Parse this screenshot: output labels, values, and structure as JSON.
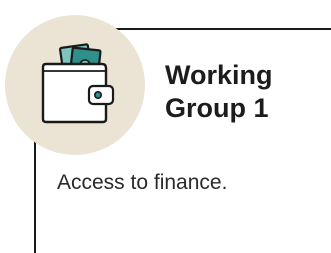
{
  "card": {
    "title_line1": "Working",
    "title_line2": "Group 1",
    "description": "Access to finance."
  },
  "icon": {
    "name": "wallet-icon",
    "badge_color": "#ebe4d4",
    "money_color": "#2f8f8a",
    "money_light": "#7fc4bf",
    "wallet_color": "#ffffff",
    "outline_color": "#1a1a1a"
  },
  "colors": {
    "text": "#1c1c1c",
    "rule": "#1a1a1a",
    "background": "#ffffff"
  }
}
